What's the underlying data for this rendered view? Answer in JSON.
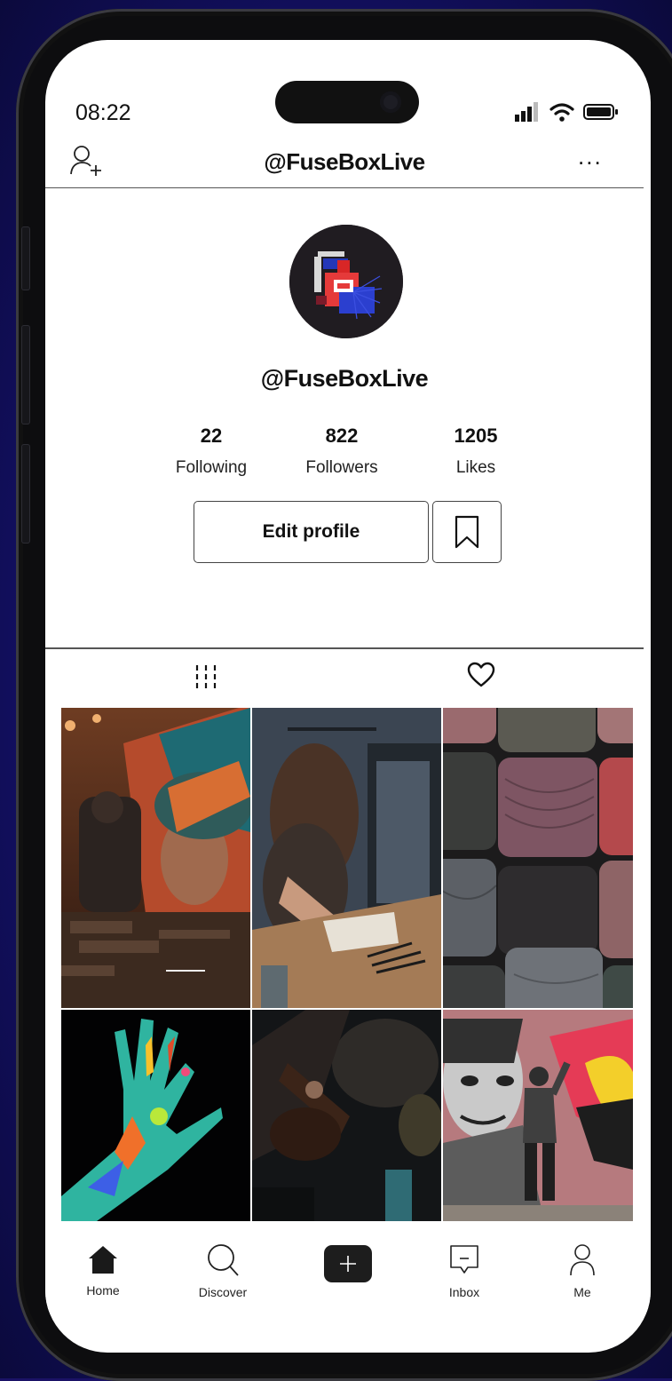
{
  "status_bar": {
    "time": "08:22"
  },
  "header": {
    "title": "@FuseBoxLive",
    "more_label": "..."
  },
  "profile": {
    "username": "@FuseBoxLive",
    "stats": [
      {
        "value": "22",
        "label": "Following"
      },
      {
        "value": "822",
        "label": "Followers"
      },
      {
        "value": "1205",
        "label": "Likes"
      }
    ],
    "edit_button_label": "Edit profile"
  },
  "tabs": {
    "videos_icon": "grid-lines-icon",
    "liked_icon": "heart-icon"
  },
  "grid_tiles": [
    {
      "description": "painting-mural-man"
    },
    {
      "description": "woman-sketching-desk"
    },
    {
      "description": "textured-blocks"
    },
    {
      "description": "neon-paint-hand"
    },
    {
      "description": "guitarist-dark"
    },
    {
      "description": "street-art-painter"
    }
  ],
  "bottom_nav": {
    "items": [
      {
        "label": "Home",
        "icon": "home-icon"
      },
      {
        "label": "Discover",
        "icon": "search-icon"
      },
      {
        "label": "",
        "icon": "plus-icon"
      },
      {
        "label": "Inbox",
        "icon": "inbox-icon"
      },
      {
        "label": "Me",
        "icon": "person-icon"
      }
    ]
  },
  "colors": {
    "background": "#1a1266",
    "screen": "#ffffff",
    "text": "#111111"
  }
}
